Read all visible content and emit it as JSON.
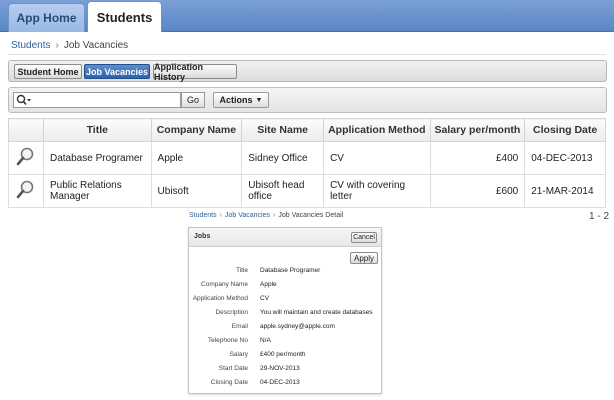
{
  "tabs": [
    {
      "label": "App Home"
    },
    {
      "label": "Students"
    }
  ],
  "breadcrumb": {
    "parent": "Students",
    "separator": "›",
    "current": "Job Vacancies"
  },
  "nav_buttons": [
    "Student Home",
    "Job Vacancies",
    "Application History"
  ],
  "search": {
    "value": "",
    "placeholder": "",
    "go_label": "Go",
    "actions_label": "Actions",
    "actions_caret": "▼"
  },
  "report": {
    "columns": [
      "Title",
      "Company Name",
      "Site Name",
      "Application Method",
      "Salary per/month",
      "Closing Date"
    ],
    "rows": [
      [
        "Database Programer",
        "Apple",
        "Sidney Office",
        "CV",
        "£400",
        "04-DEC-2013"
      ],
      [
        "Public Relations Manager",
        "Ubisoft",
        "Ubisoft head office",
        "CV with covering letter",
        "£600",
        "21-MAR-2014"
      ]
    ],
    "pagination": "1 - 2"
  },
  "detail_breadcrumb": {
    "items": [
      "Students",
      "Job Vacancies",
      "Job Vacancies Detail"
    ],
    "separator": "›"
  },
  "jobs_panel": {
    "title": "Jobs",
    "cancel_label": "Cancel",
    "apply_label": "Apply",
    "fields": [
      {
        "label": "Title",
        "value": "Database Programer"
      },
      {
        "label": "Company Name",
        "value": "Apple"
      },
      {
        "label": "Application Method",
        "value": "CV"
      },
      {
        "label": "Description",
        "value": "You will maintain and create databases"
      },
      {
        "label": "Email",
        "value": "apple.sydney@apple.com"
      },
      {
        "label": "Telephone No",
        "value": "N/A"
      },
      {
        "label": "Salary",
        "value": "£400 per/month"
      },
      {
        "label": "Start Date",
        "value": "29-NOV-2013"
      },
      {
        "label": "Closing Date",
        "value": "04-DEC-2013"
      }
    ]
  },
  "colors": {
    "topbar": "#5a86c6",
    "link": "#2e5f99",
    "active_nav": "#2c62ae"
  },
  "icons": {
    "search": "search-icon",
    "row": "magnifier-icon"
  }
}
